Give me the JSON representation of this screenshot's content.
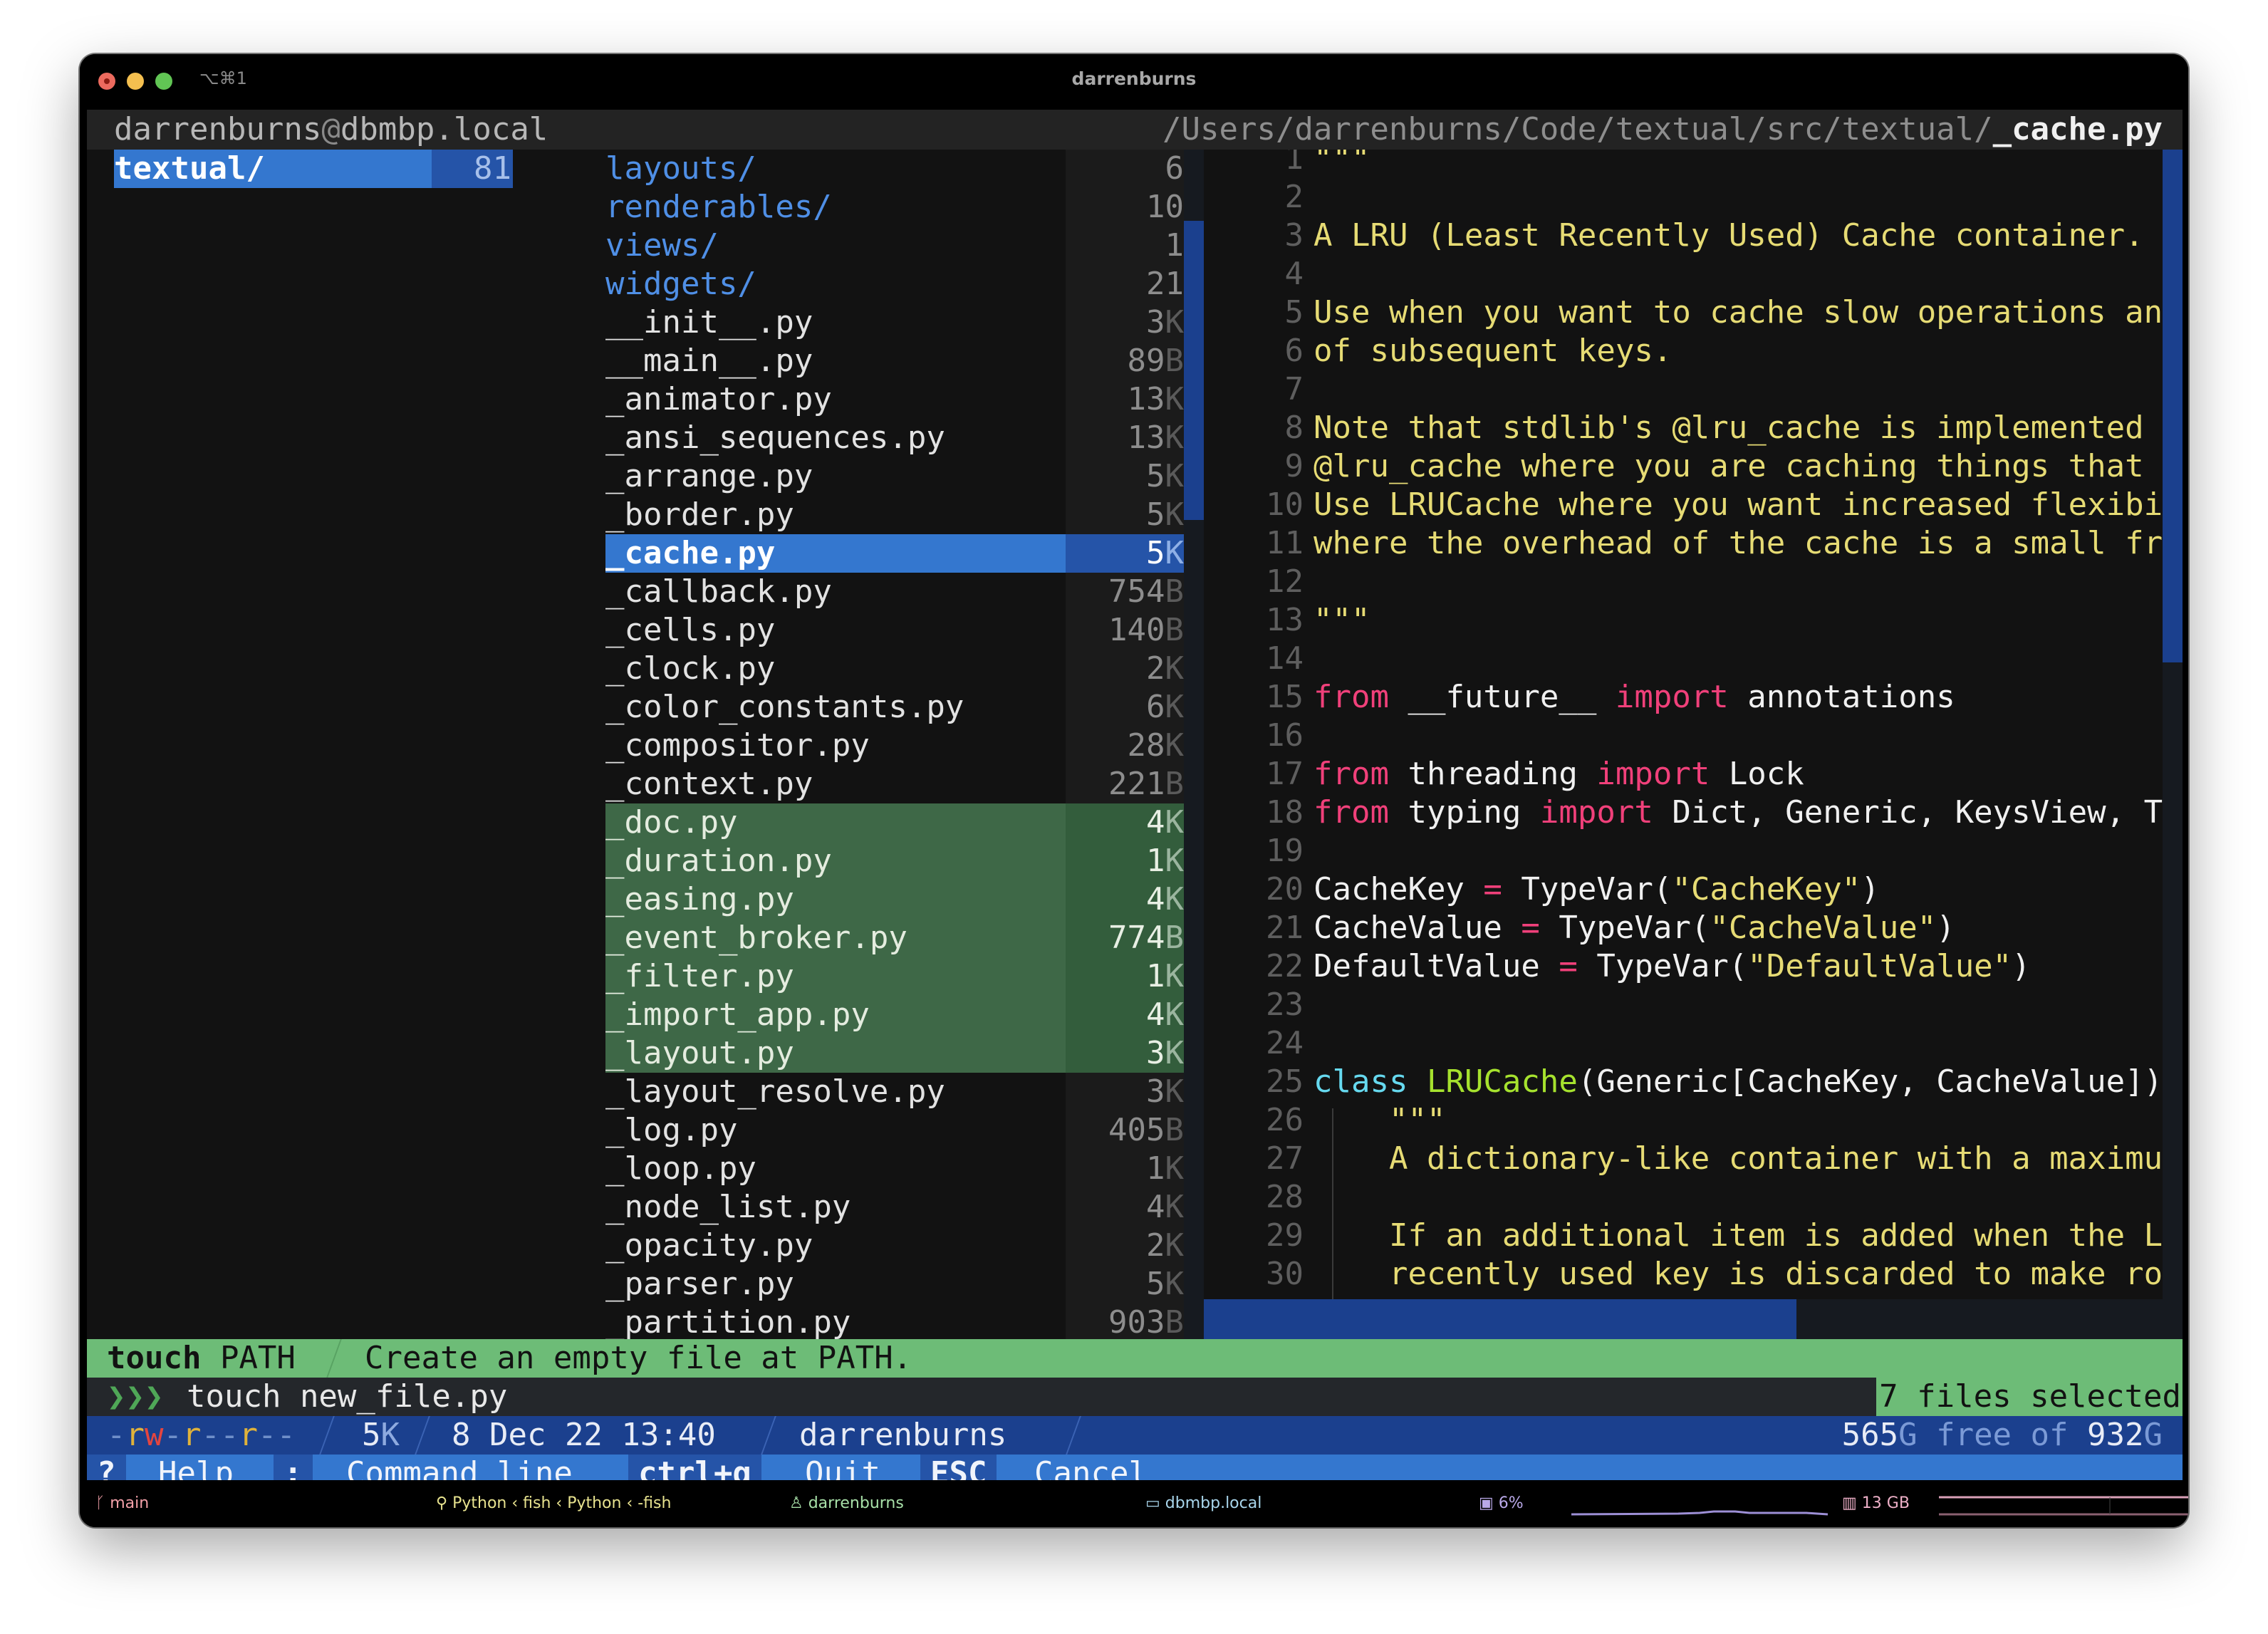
{
  "window": {
    "title": "darrenburns",
    "tab_shortcut": "⌥⌘1"
  },
  "header": {
    "user": "darrenburns",
    "at": "@",
    "host": "dbmbp.local",
    "path_prefix": "/Users/darrenburns/Code/textual/src/textual/",
    "path_file": "_cache.py"
  },
  "parent_column": {
    "name": "textual/",
    "count": "81"
  },
  "files": [
    {
      "name": "layouts/",
      "size": "6",
      "unit": "",
      "type": "dir",
      "state": "normal"
    },
    {
      "name": "renderables/",
      "size": "10",
      "unit": "",
      "type": "dir",
      "state": "normal"
    },
    {
      "name": "views/",
      "size": "1",
      "unit": "",
      "type": "dir",
      "state": "normal"
    },
    {
      "name": "widgets/",
      "size": "21",
      "unit": "",
      "type": "dir",
      "state": "normal"
    },
    {
      "name": "__init__.py",
      "size": "3",
      "unit": "K",
      "type": "file",
      "state": "normal"
    },
    {
      "name": "__main__.py",
      "size": "89",
      "unit": "B",
      "type": "file",
      "state": "normal"
    },
    {
      "name": "_animator.py",
      "size": "13",
      "unit": "K",
      "type": "file",
      "state": "normal"
    },
    {
      "name": "_ansi_sequences.py",
      "size": "13",
      "unit": "K",
      "type": "file",
      "state": "normal"
    },
    {
      "name": "_arrange.py",
      "size": "5",
      "unit": "K",
      "type": "file",
      "state": "normal"
    },
    {
      "name": "_border.py",
      "size": "5",
      "unit": "K",
      "type": "file",
      "state": "normal"
    },
    {
      "name": "_cache.py",
      "size": "5",
      "unit": "K",
      "type": "file",
      "state": "current"
    },
    {
      "name": "_callback.py",
      "size": "754",
      "unit": "B",
      "type": "file",
      "state": "normal"
    },
    {
      "name": "_cells.py",
      "size": "140",
      "unit": "B",
      "type": "file",
      "state": "normal"
    },
    {
      "name": "_clock.py",
      "size": "2",
      "unit": "K",
      "type": "file",
      "state": "normal"
    },
    {
      "name": "_color_constants.py",
      "size": "6",
      "unit": "K",
      "type": "file",
      "state": "normal"
    },
    {
      "name": "_compositor.py",
      "size": "28",
      "unit": "K",
      "type": "file",
      "state": "normal"
    },
    {
      "name": "_context.py",
      "size": "221",
      "unit": "B",
      "type": "file",
      "state": "normal"
    },
    {
      "name": "_doc.py",
      "size": "4",
      "unit": "K",
      "type": "file",
      "state": "selected"
    },
    {
      "name": "_duration.py",
      "size": "1",
      "unit": "K",
      "type": "file",
      "state": "selected"
    },
    {
      "name": "_easing.py",
      "size": "4",
      "unit": "K",
      "type": "file",
      "state": "selected"
    },
    {
      "name": "_event_broker.py",
      "size": "774",
      "unit": "B",
      "type": "file",
      "state": "selected"
    },
    {
      "name": "_filter.py",
      "size": "1",
      "unit": "K",
      "type": "file",
      "state": "selected"
    },
    {
      "name": "_import_app.py",
      "size": "4",
      "unit": "K",
      "type": "file",
      "state": "selected"
    },
    {
      "name": "_layout.py",
      "size": "3",
      "unit": "K",
      "type": "file",
      "state": "selected"
    },
    {
      "name": "_layout_resolve.py",
      "size": "3",
      "unit": "K",
      "type": "file",
      "state": "normal"
    },
    {
      "name": "_log.py",
      "size": "405",
      "unit": "B",
      "type": "file",
      "state": "normal"
    },
    {
      "name": "_loop.py",
      "size": "1",
      "unit": "K",
      "type": "file",
      "state": "normal"
    },
    {
      "name": "_node_list.py",
      "size": "4",
      "unit": "K",
      "type": "file",
      "state": "normal"
    },
    {
      "name": "_opacity.py",
      "size": "2",
      "unit": "K",
      "type": "file",
      "state": "normal"
    },
    {
      "name": "_parser.py",
      "size": "5",
      "unit": "K",
      "type": "file",
      "state": "normal"
    },
    {
      "name": "_partition.py",
      "size": "903",
      "unit": "B",
      "type": "file",
      "state": "normal"
    }
  ],
  "code": {
    "lines": [
      {
        "n": "1",
        "tokens": [
          {
            "t": "\"\"\"",
            "c": "doc"
          }
        ]
      },
      {
        "n": "2",
        "tokens": []
      },
      {
        "n": "3",
        "tokens": [
          {
            "t": "A LRU (Least Recently Used) Cache container.",
            "c": "doc"
          }
        ]
      },
      {
        "n": "4",
        "tokens": []
      },
      {
        "n": "5",
        "tokens": [
          {
            "t": "Use when you want to cache slow operations and",
            "c": "doc"
          }
        ]
      },
      {
        "n": "6",
        "tokens": [
          {
            "t": "of subsequent keys.",
            "c": "doc"
          }
        ]
      },
      {
        "n": "7",
        "tokens": []
      },
      {
        "n": "8",
        "tokens": [
          {
            "t": "Note that stdlib's @lru_cache is implemented i",
            "c": "doc"
          }
        ]
      },
      {
        "n": "9",
        "tokens": [
          {
            "t": "@lru_cache where you are caching things that a",
            "c": "doc"
          }
        ]
      },
      {
        "n": "10",
        "tokens": [
          {
            "t": "Use LRUCache where you want increased flexibil",
            "c": "doc"
          }
        ]
      },
      {
        "n": "11",
        "tokens": [
          {
            "t": "where the overhead of the cache is a small fra",
            "c": "doc"
          }
        ]
      },
      {
        "n": "12",
        "tokens": []
      },
      {
        "n": "13",
        "tokens": [
          {
            "t": "\"\"\"",
            "c": "doc"
          }
        ]
      },
      {
        "n": "14",
        "tokens": []
      },
      {
        "n": "15",
        "tokens": [
          {
            "t": "from",
            "c": "kw"
          },
          {
            "t": " __future__ ",
            "c": "plain"
          },
          {
            "t": "import",
            "c": "kw"
          },
          {
            "t": " annotations",
            "c": "plain"
          }
        ]
      },
      {
        "n": "16",
        "tokens": []
      },
      {
        "n": "17",
        "tokens": [
          {
            "t": "from",
            "c": "kw"
          },
          {
            "t": " threading ",
            "c": "plain"
          },
          {
            "t": "import",
            "c": "kw"
          },
          {
            "t": " Lock",
            "c": "plain"
          }
        ]
      },
      {
        "n": "18",
        "tokens": [
          {
            "t": "from",
            "c": "kw"
          },
          {
            "t": " typing ",
            "c": "plain"
          },
          {
            "t": "import",
            "c": "kw"
          },
          {
            "t": " Dict, Generic, KeysView, Ty",
            "c": "plain"
          }
        ]
      },
      {
        "n": "19",
        "tokens": []
      },
      {
        "n": "20",
        "tokens": [
          {
            "t": "CacheKey ",
            "c": "plain"
          },
          {
            "t": "=",
            "c": "op"
          },
          {
            "t": " TypeVar(",
            "c": "plain"
          },
          {
            "t": "\"CacheKey\"",
            "c": "str"
          },
          {
            "t": ")",
            "c": "plain"
          }
        ]
      },
      {
        "n": "21",
        "tokens": [
          {
            "t": "CacheValue ",
            "c": "plain"
          },
          {
            "t": "=",
            "c": "op"
          },
          {
            "t": " TypeVar(",
            "c": "plain"
          },
          {
            "t": "\"CacheValue\"",
            "c": "str"
          },
          {
            "t": ")",
            "c": "plain"
          }
        ]
      },
      {
        "n": "22",
        "tokens": [
          {
            "t": "DefaultValue ",
            "c": "plain"
          },
          {
            "t": "=",
            "c": "op"
          },
          {
            "t": " TypeVar(",
            "c": "plain"
          },
          {
            "t": "\"DefaultValue\"",
            "c": "str"
          },
          {
            "t": ")",
            "c": "plain"
          }
        ]
      },
      {
        "n": "23",
        "tokens": []
      },
      {
        "n": "24",
        "tokens": []
      },
      {
        "n": "25",
        "tokens": [
          {
            "t": "class",
            "c": "cls"
          },
          {
            "t": " ",
            "c": "plain"
          },
          {
            "t": "LRUCache",
            "c": "name"
          },
          {
            "t": "(Generic[CacheKey, CacheValue]):",
            "c": "plain"
          }
        ]
      },
      {
        "n": "26",
        "tokens": [
          {
            "t": "    \"\"\"",
            "c": "doc"
          }
        ]
      },
      {
        "n": "27",
        "tokens": [
          {
            "t": "    A dictionary-like container with a maximum",
            "c": "doc"
          }
        ]
      },
      {
        "n": "28",
        "tokens": []
      },
      {
        "n": "29",
        "tokens": [
          {
            "t": "    If an additional item is added when the LR",
            "c": "doc"
          }
        ]
      },
      {
        "n": "30",
        "tokens": [
          {
            "t": "    recently used key is discarded to make roo",
            "c": "doc"
          }
        ]
      }
    ]
  },
  "hint": {
    "command": "touch",
    "argument": "PATH",
    "description": "Create an empty file at PATH."
  },
  "command_line": {
    "prompt": "❯❯❯",
    "value": "touch new_file.py",
    "selection_count": "7 files selected"
  },
  "status": {
    "permissions": "-rw-r--r--",
    "size_value": "5",
    "size_unit": "K",
    "modified": "8 Dec 22 13:40",
    "owner": "darrenburns",
    "disk_free_value": "565",
    "disk_free_unit": "G",
    "disk_free_label": " free of ",
    "disk_total_value": "932",
    "disk_total_unit": "G"
  },
  "footer": {
    "bindings": [
      {
        "key": "?",
        "label": "Help"
      },
      {
        "key": ":",
        "label": "Command line"
      },
      {
        "key": "ctrl+q",
        "label": "Quit"
      },
      {
        "key": "ESC",
        "label": "Cancel"
      }
    ]
  },
  "tmux": {
    "git_branch": "main",
    "process_chain": "Python ‹ fish ‹ Python ‹ -fish",
    "user": "darrenburns",
    "host": "dbmbp.local",
    "cpu_percent": "6%",
    "memory": "13 GB"
  },
  "colors": {
    "accent_blue": "#3477cf",
    "accent_blue_dark": "#1b408e",
    "selection_green": "#3e6847",
    "hint_green": "#6dbc77",
    "docstring_yellow": "#e6db74",
    "keyword_pink": "#f0407a",
    "directory_blue": "#4f8fe6"
  }
}
